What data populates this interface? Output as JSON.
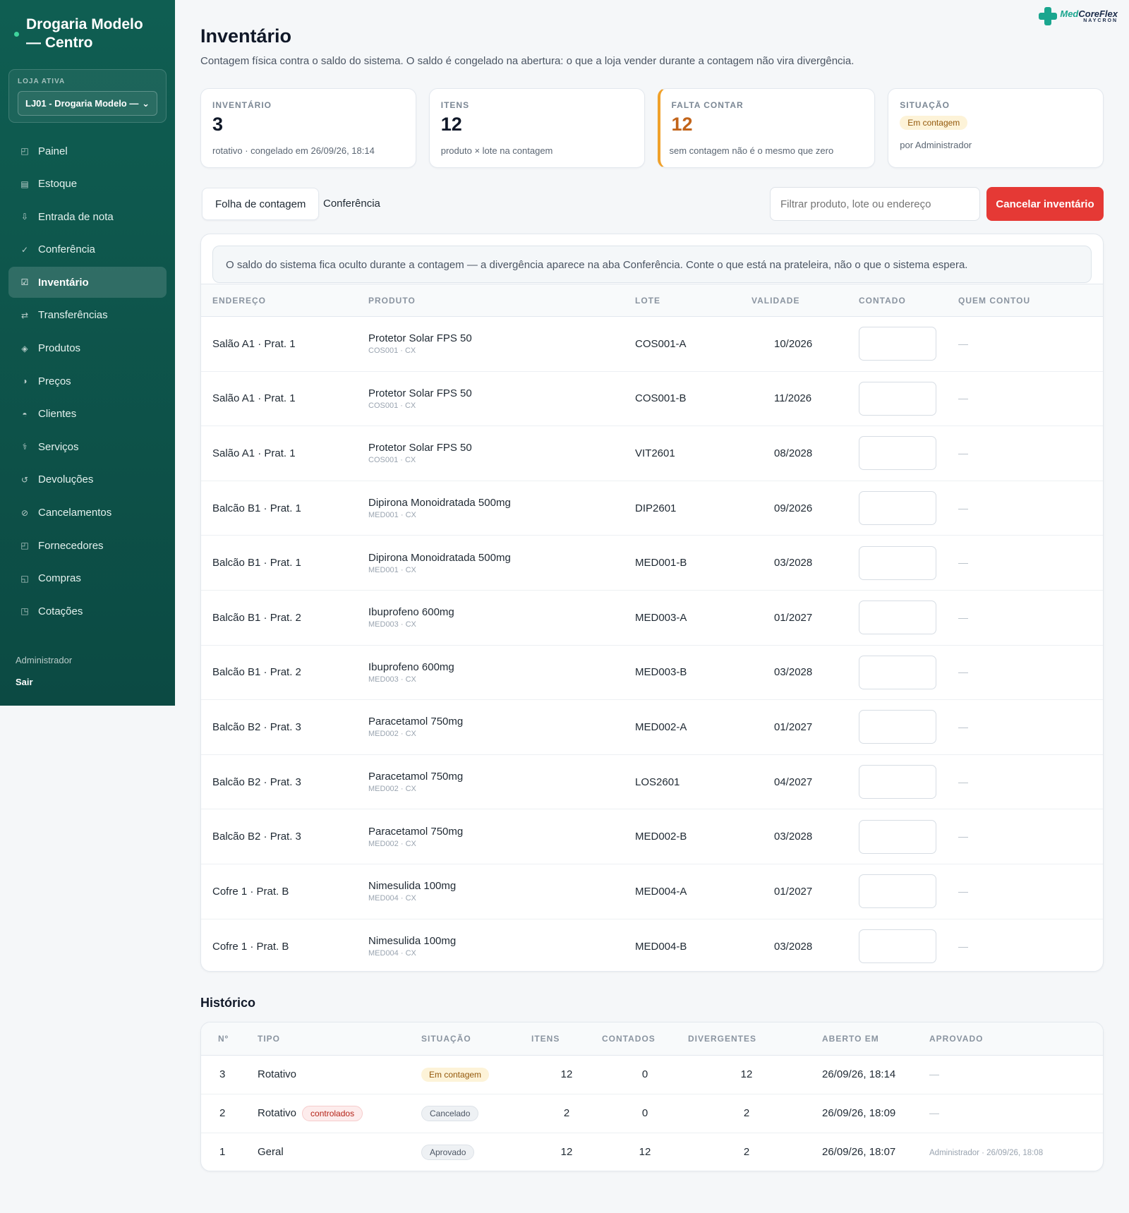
{
  "sidebar": {
    "brand": "Drogaria Modelo — Centro",
    "store_label": "LOJA ATIVA",
    "store_value": "LJ01 - Drogaria Modelo —",
    "items": [
      {
        "label": "Painel",
        "icon": "◰"
      },
      {
        "label": "Estoque",
        "icon": "▤"
      },
      {
        "label": "Entrada de nota",
        "icon": "⇩"
      },
      {
        "label": "Conferência",
        "icon": "✓"
      },
      {
        "label": "Inventário",
        "icon": "☑"
      },
      {
        "label": "Transferências",
        "icon": "⇄"
      },
      {
        "label": "Produtos",
        "icon": "◈"
      },
      {
        "label": "Preços",
        "icon": "◑"
      },
      {
        "label": "Clientes",
        "icon": "◓"
      },
      {
        "label": "Serviços",
        "icon": "⚕"
      },
      {
        "label": "Devoluções",
        "icon": "↺"
      },
      {
        "label": "Cancelamentos",
        "icon": "⊘"
      },
      {
        "label": "Fornecedores",
        "icon": "◰"
      },
      {
        "label": "Compras",
        "icon": "◱"
      },
      {
        "label": "Cotações",
        "icon": "◳"
      }
    ],
    "active_index": 4,
    "user": "Administrador",
    "logout": "Sair"
  },
  "logo": {
    "name_a": "Med",
    "name_b": "CoreFlex",
    "sub": "NAYCRON"
  },
  "page": {
    "title": "Inventário",
    "subtitle": "Contagem física contra o saldo do sistema. O saldo é congelado na abertura: o que a loja vender durante a contagem não vira divergência."
  },
  "cards": {
    "inventario": {
      "label": "INVENTÁRIO",
      "value": "3",
      "note": "rotativo · congelado em 26/09/26, 18:14"
    },
    "itens": {
      "label": "ITENS",
      "value": "12",
      "note": "produto × lote na contagem"
    },
    "falta": {
      "label": "FALTA CONTAR",
      "value": "12",
      "note": "sem contagem não é o mesmo que zero"
    },
    "situacao": {
      "label": "SITUAÇÃO",
      "status": "Em contagem",
      "note": "por Administrador"
    }
  },
  "tabs": {
    "sheet": "Folha de contagem",
    "conf": "Conferência"
  },
  "filter": {
    "placeholder": "Filtrar produto, lote ou endereço"
  },
  "cancel_button": "Cancelar inventário",
  "notice": "O saldo do sistema fica oculto durante a contagem — a divergência aparece na aba Conferência. Conte o que está na prateleira, não o que o sistema espera.",
  "count_table": {
    "headers": {
      "end": "ENDEREÇO",
      "prod": "PRODUTO",
      "lote": "LOTE",
      "val": "VALIDADE",
      "cont": "CONTADO",
      "quem": "QUEM CONTOU"
    },
    "rows": [
      {
        "end": "Salão A1 · Prat. 1",
        "prod": "Protetor Solar FPS 50",
        "sub": "COS001 · CX",
        "lote": "COS001-A",
        "val": "10/2026",
        "quem": "—"
      },
      {
        "end": "Salão A1 · Prat. 1",
        "prod": "Protetor Solar FPS 50",
        "sub": "COS001 · CX",
        "lote": "COS001-B",
        "val": "11/2026",
        "quem": "—"
      },
      {
        "end": "Salão A1 · Prat. 1",
        "prod": "Protetor Solar FPS 50",
        "sub": "COS001 · CX",
        "lote": "VIT2601",
        "val": "08/2028",
        "quem": "—"
      },
      {
        "end": "Balcão B1 · Prat. 1",
        "prod": "Dipirona Monoidratada 500mg",
        "sub": "MED001 · CX",
        "lote": "DIP2601",
        "val": "09/2026",
        "quem": "—"
      },
      {
        "end": "Balcão B1 · Prat. 1",
        "prod": "Dipirona Monoidratada 500mg",
        "sub": "MED001 · CX",
        "lote": "MED001-B",
        "val": "03/2028",
        "quem": "—"
      },
      {
        "end": "Balcão B1 · Prat. 2",
        "prod": "Ibuprofeno 600mg",
        "sub": "MED003 · CX",
        "lote": "MED003-A",
        "val": "01/2027",
        "quem": "—"
      },
      {
        "end": "Balcão B1 · Prat. 2",
        "prod": "Ibuprofeno 600mg",
        "sub": "MED003 · CX",
        "lote": "MED003-B",
        "val": "03/2028",
        "quem": "—"
      },
      {
        "end": "Balcão B2 · Prat. 3",
        "prod": "Paracetamol 750mg",
        "sub": "MED002 · CX",
        "lote": "MED002-A",
        "val": "01/2027",
        "quem": "—"
      },
      {
        "end": "Balcão B2 · Prat. 3",
        "prod": "Paracetamol 750mg",
        "sub": "MED002 · CX",
        "lote": "LOS2601",
        "val": "04/2027",
        "quem": "—"
      },
      {
        "end": "Balcão B2 · Prat. 3",
        "prod": "Paracetamol 750mg",
        "sub": "MED002 · CX",
        "lote": "MED002-B",
        "val": "03/2028",
        "quem": "—"
      },
      {
        "end": "Cofre 1 · Prat. B",
        "prod": "Nimesulida 100mg",
        "sub": "MED004 · CX",
        "lote": "MED004-A",
        "val": "01/2027",
        "quem": "—"
      },
      {
        "end": "Cofre 1 · Prat. B",
        "prod": "Nimesulida 100mg",
        "sub": "MED004 · CX",
        "lote": "MED004-B",
        "val": "03/2028",
        "quem": "—"
      }
    ]
  },
  "history": {
    "title": "Histórico",
    "headers": {
      "n": "Nº",
      "tipo": "TIPO",
      "sit": "SITUAÇÃO",
      "itens": "ITENS",
      "cont": "CONTADOS",
      "div": "DIVERGENTES",
      "aberto": "ABERTO EM",
      "aprov": "APROVADO"
    },
    "rows": [
      {
        "n": "3",
        "tipo": "Rotativo",
        "tag": "",
        "sit": "Em contagem",
        "sit_style": "yellow",
        "itens": "12",
        "cont": "0",
        "div": "12",
        "aberto": "26/09/26, 18:14",
        "aprov": "—"
      },
      {
        "n": "2",
        "tipo": "Rotativo",
        "tag": "controlados",
        "sit": "Cancelado",
        "sit_style": "gray",
        "itens": "2",
        "cont": "0",
        "div": "2",
        "aberto": "26/09/26, 18:09",
        "aprov": "—"
      },
      {
        "n": "1",
        "tipo": "Geral",
        "tag": "",
        "sit": "Aprovado",
        "sit_style": "gray",
        "itens": "12",
        "cont": "12",
        "div": "2",
        "aberto": "26/09/26, 18:07",
        "aprov": "Administrador · 26/09/26, 18:08"
      }
    ]
  }
}
